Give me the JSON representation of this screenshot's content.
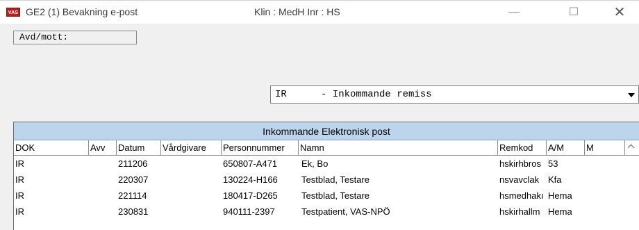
{
  "window": {
    "app_icon_label": "VAS",
    "title_left": "GE2 (1) Bevakning e-post",
    "title_mid": "Klin : MedH  Inr : HS",
    "minimize_glyph": "—",
    "maximize_glyph": "☐",
    "close_glyph": "✕"
  },
  "avd_mott": {
    "label": "Avd/mott:"
  },
  "document_type": {
    "code": "IR",
    "text": "- Inkommande remiss"
  },
  "grid": {
    "caption": "Inkommande Elektronisk post",
    "columns": [
      "DOK",
      "Avv",
      "Datum",
      "Vårdgivare",
      "Personnummer",
      "Namn",
      "Remkod",
      "A/M",
      "M"
    ],
    "rows": [
      {
        "dok": "IR",
        "avv": "",
        "datum": "211206",
        "vardgivare": "",
        "personnummer": "650807-A471",
        "namn": "Ek, Bo",
        "remkod": "hskirhbros",
        "am": "53",
        "m": ""
      },
      {
        "dok": "IR",
        "avv": "",
        "datum": "220307",
        "vardgivare": "",
        "personnummer": "130224-H166",
        "namn": "Testblad, Testare",
        "remkod": "nsvavclak",
        "am": "Kfa",
        "m": ""
      },
      {
        "dok": "IR",
        "avv": "",
        "datum": "221114",
        "vardgivare": "",
        "personnummer": "180417-D265",
        "namn": "Testblad, Testare",
        "remkod": "hsmedhakı",
        "am": "Hema",
        "m": ""
      },
      {
        "dok": "IR",
        "avv": "",
        "datum": "230831",
        "vardgivare": "",
        "personnummer": "940111-2397",
        "namn": "Testpatient, VAS-NPÖ",
        "remkod": "hskirhallm",
        "am": "Hema",
        "m": ""
      }
    ]
  }
}
